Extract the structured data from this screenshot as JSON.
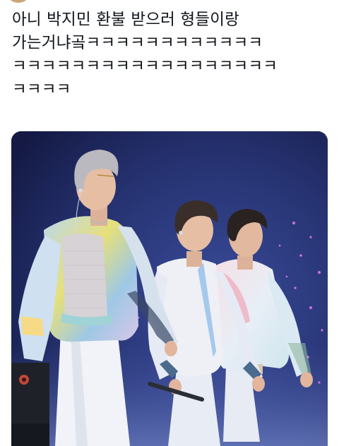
{
  "tweet": {
    "lines": [
      "아니 박지민 환불 받으러 형들이랑",
      "가는거냐곸ㅋㅋㅋㅋㅋㅋㅋㅋㅋㅋㅋㅋ",
      "ㅋㅋㅋㅋㅋㅋㅋㅋㅋㅋㅋㅋㅋㅋㅋㅋㅋㅋ",
      "ㅋㅋㅋㅋ"
    ]
  },
  "media": {
    "type": "photo",
    "subject": "three performers walking on a concert stage",
    "colors": {
      "background": "#1a2252",
      "haze": "#3a4c9a",
      "sparkle": "#d070e0",
      "outfit_white": "#eef0f6",
      "hair_silver": "#b9b9bf",
      "hair_dark": "#2a2220"
    }
  }
}
